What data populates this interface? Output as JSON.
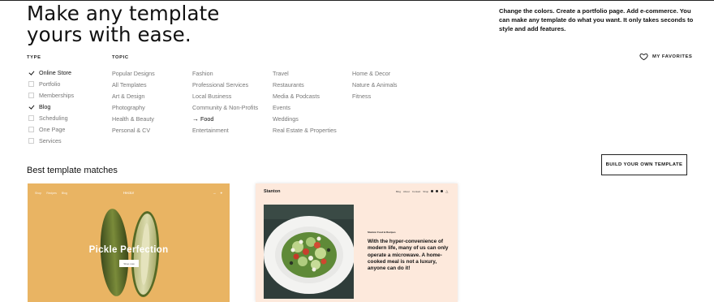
{
  "headline": "Make any template yours with ease.",
  "intro": "Change the colors. Create a portfolio page. Add e-commerce. You can make any template do what you want. It only takes seconds to style and add features.",
  "filters": {
    "type_label": "TYPE",
    "topic_label": "TOPIC",
    "types": [
      {
        "label": "Online Store",
        "checked": true
      },
      {
        "label": "Portfolio",
        "checked": false
      },
      {
        "label": "Memberships",
        "checked": false
      },
      {
        "label": "Blog",
        "checked": true
      },
      {
        "label": "Scheduling",
        "checked": false
      },
      {
        "label": "One Page",
        "checked": false
      },
      {
        "label": "Services",
        "checked": false
      }
    ],
    "topics": [
      [
        "Popular Designs",
        "All Templates",
        "Art & Design",
        "Photography",
        "Health & Beauty",
        "Personal & CV"
      ],
      [
        "Fashion",
        "Professional Services",
        "Local Business",
        "Community & Non-Profits",
        "Food",
        "Entertainment"
      ],
      [
        "Travel",
        "Restaurants",
        "Media & Podcasts",
        "Events",
        "Weddings",
        "Real Estate & Properties"
      ],
      [
        "Home & Decor",
        "Nature & Animals",
        "Fitness"
      ]
    ],
    "active_topic": "Food"
  },
  "favorites_label": "MY FAVORITES",
  "best_matches_title": "Best template matches",
  "build_button": "BUILD YOUR OWN TEMPLATE",
  "cards": {
    "card1": {
      "nav": [
        "Shop",
        "Recipes",
        "Blog"
      ],
      "brand": "Hector",
      "icons": [
        "→",
        "⌖"
      ],
      "title": "Pickle Perfection",
      "button": "Shop now",
      "background": "#e9b463"
    },
    "card2": {
      "brand": "Stanton",
      "nav": [
        "Blog",
        "About",
        "Contact",
        "Shop"
      ],
      "kicker": "Stanton Food & Recipes",
      "body": "With the hyper-convenience of modern life, many of us can only operate a microwave. A home-cooked meal is not a luxury, anyone can do it!",
      "background": "#fde9dc"
    }
  },
  "icons": {
    "favorites": "heart-icon",
    "check": "checkmark-icon",
    "arrow": "arrow-right-icon"
  }
}
